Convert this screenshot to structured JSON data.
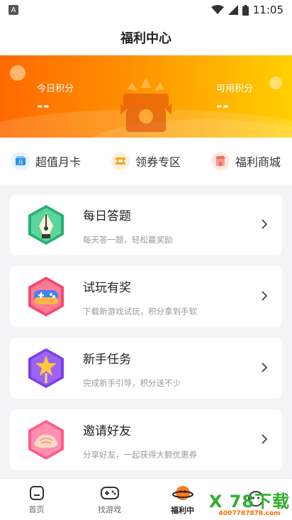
{
  "status_bar": {
    "time": "11:05"
  },
  "header": {
    "title": "福利中心"
  },
  "banner": {
    "today_points_label": "今日积分",
    "today_points_value": "--",
    "available_points_label": "可用积分",
    "available_points_value": "--"
  },
  "quick_links": [
    {
      "label": "超值月卡",
      "icon": "card-icon",
      "color": "#2f8fe8"
    },
    {
      "label": "领券专区",
      "icon": "coupon-icon",
      "color": "#f5a623"
    },
    {
      "label": "福利商城",
      "icon": "store-icon",
      "color": "#ef6f5d"
    }
  ],
  "tasks": [
    {
      "title": "每日答题",
      "desc": "每天答一题，轻松赢奖励",
      "icon": "pen-nib-icon"
    },
    {
      "title": "试玩有奖",
      "desc": "下载新游戏试玩，积分拿到手软",
      "icon": "gamepad-icon"
    },
    {
      "title": "新手任务",
      "desc": "完成新手引导，积分送不少",
      "icon": "star-wand-icon"
    },
    {
      "title": "邀请好友",
      "desc": "分享好友，一起获得大额优惠券",
      "icon": "handshake-icon"
    }
  ],
  "tab_bar": [
    {
      "label": "首页",
      "icon": "home-icon"
    },
    {
      "label": "找游戏",
      "icon": "gamepad-icon"
    },
    {
      "label": "福利中",
      "icon": "planet-mascot-icon",
      "active": true
    },
    {
      "label": "",
      "icon": "profile-icon"
    }
  ],
  "watermark": {
    "main": "X 78下载",
    "sub": "4007787878.com"
  },
  "colors": {
    "accent_orange": "#ff7a00",
    "accent_yellow": "#ffd000"
  }
}
